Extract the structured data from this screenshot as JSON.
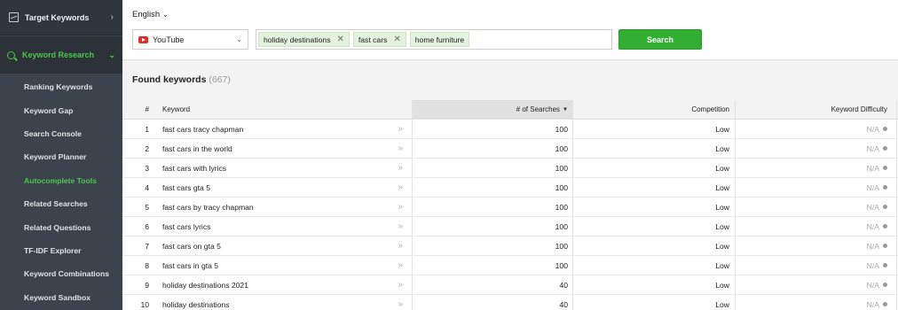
{
  "sidebar": {
    "top_label": "Target Keywords",
    "section_label": "Keyword Research",
    "items": [
      {
        "label": "Ranking Keywords"
      },
      {
        "label": "Keyword Gap"
      },
      {
        "label": "Search Console"
      },
      {
        "label": "Keyword Planner"
      },
      {
        "label": "Autocomplete Tools",
        "current": true
      },
      {
        "label": "Related Searches"
      },
      {
        "label": "Related Questions"
      },
      {
        "label": "TF-IDF Explorer"
      },
      {
        "label": "Keyword Combinations"
      },
      {
        "label": "Keyword Sandbox"
      }
    ]
  },
  "topbar": {
    "language": "English",
    "source": "YouTube",
    "tags": [
      "holiday destinations",
      "fast cars",
      "home furniture"
    ],
    "search_label": "Search"
  },
  "found": {
    "title": "Found keywords",
    "count": "(667)"
  },
  "table": {
    "headers": {
      "num": "#",
      "keyword": "Keyword",
      "searches": "# of Searches",
      "competition": "Competition",
      "difficulty": "Keyword Difficulty"
    },
    "rows": [
      {
        "num": "1",
        "keyword": "fast cars tracy chapman",
        "searches": "100",
        "competition": "Low",
        "difficulty": "N/A"
      },
      {
        "num": "2",
        "keyword": "fast cars in the world",
        "searches": "100",
        "competition": "Low",
        "difficulty": "N/A"
      },
      {
        "num": "3",
        "keyword": "fast cars with lyrics",
        "searches": "100",
        "competition": "Low",
        "difficulty": "N/A"
      },
      {
        "num": "4",
        "keyword": "fast cars gta 5",
        "searches": "100",
        "competition": "Low",
        "difficulty": "N/A"
      },
      {
        "num": "5",
        "keyword": "fast cars by tracy chapman",
        "searches": "100",
        "competition": "Low",
        "difficulty": "N/A"
      },
      {
        "num": "6",
        "keyword": "fast cars lyrics",
        "searches": "100",
        "competition": "Low",
        "difficulty": "N/A"
      },
      {
        "num": "7",
        "keyword": "fast cars on gta 5",
        "searches": "100",
        "competition": "Low",
        "difficulty": "N/A"
      },
      {
        "num": "8",
        "keyword": "fast cars in gta 5",
        "searches": "100",
        "competition": "Low",
        "difficulty": "N/A"
      },
      {
        "num": "9",
        "keyword": "holiday destinations 2021",
        "searches": "40",
        "competition": "Low",
        "difficulty": "N/A"
      },
      {
        "num": "10",
        "keyword": "holiday destinations",
        "searches": "40",
        "competition": "Low",
        "difficulty": "N/A"
      }
    ]
  },
  "colors": {
    "accent": "#32ae32",
    "sidebar_bg": "#3b444d",
    "tag_bg": "#e3f2dc"
  }
}
